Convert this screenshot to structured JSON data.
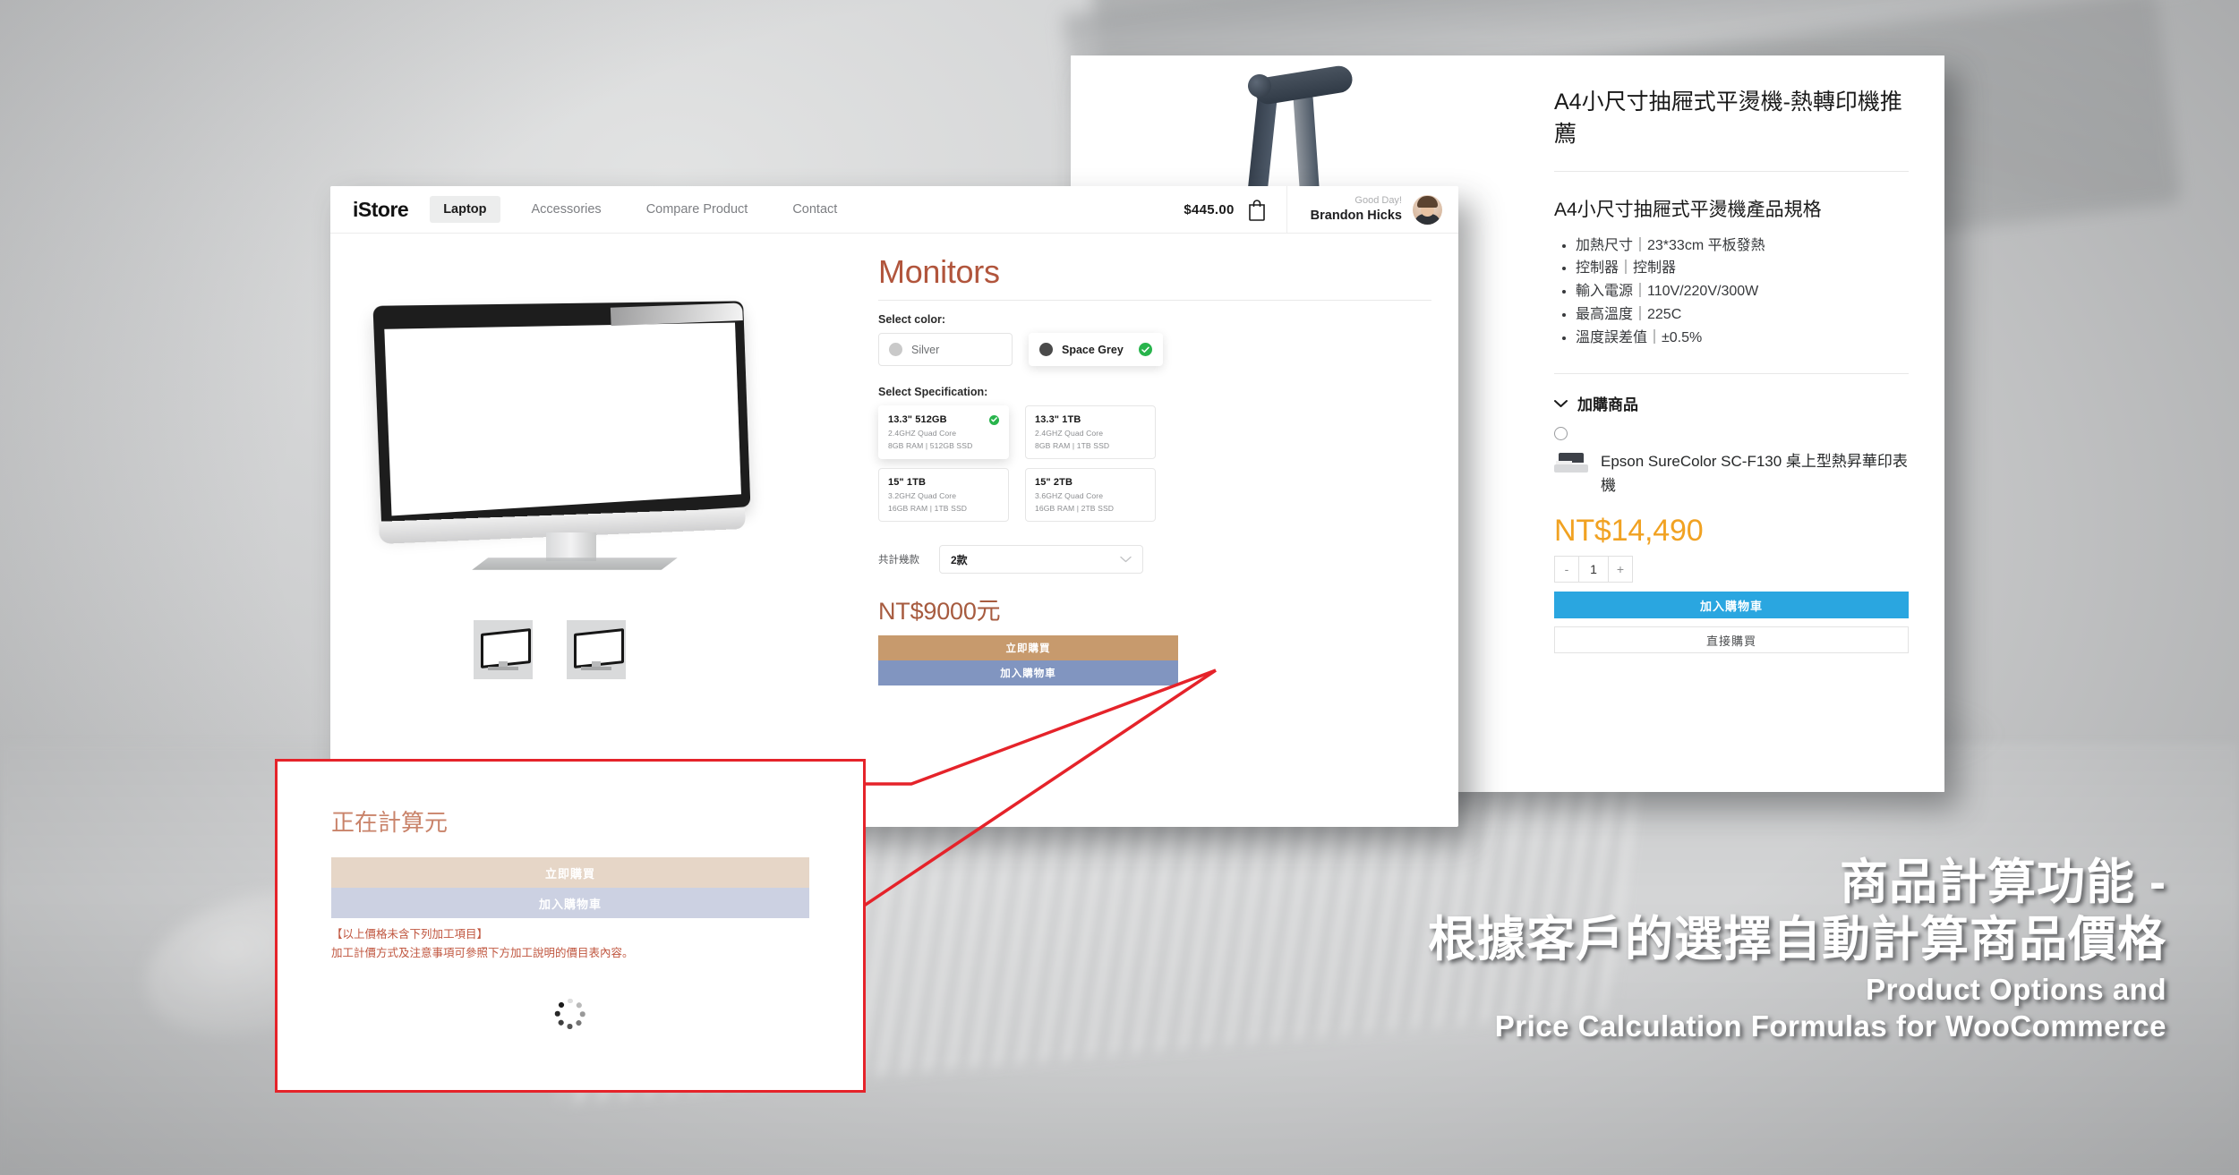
{
  "istore": {
    "brand": "iStore",
    "nav": [
      {
        "label": "Laptop",
        "active": true
      },
      {
        "label": "Accessories",
        "active": false
      },
      {
        "label": "Compare Product",
        "active": false
      },
      {
        "label": "Contact",
        "active": false
      }
    ],
    "cart_total": "$445.00",
    "cart_icon": "shopping-bag-icon",
    "greeting": "Good Day!",
    "user_name": "Brandon Hicks",
    "product_title": "Monitors",
    "color_label": "Select color:",
    "colors": [
      {
        "name": "Silver",
        "swatch": "#c9c9c9",
        "selected": false
      },
      {
        "name": "Space Grey",
        "swatch": "#4a4a4a",
        "selected": true
      }
    ],
    "spec_label": "Select Specification:",
    "specs": [
      {
        "title": "13.3\" 512GB",
        "cpu": "2.4GHZ Quad Core",
        "mem": "8GB RAM | 512GB SSD",
        "selected": true
      },
      {
        "title": "13.3\" 1TB",
        "cpu": "2.4GHZ Quad Core",
        "mem": "8GB RAM | 1TB SSD",
        "selected": false
      },
      {
        "title": "15\" 1TB",
        "cpu": "3.2GHZ Quad Core",
        "mem": "16GB RAM | 1TB SSD",
        "selected": false
      },
      {
        "title": "15\" 2TB",
        "cpu": "3.6GHZ Quad Core",
        "mem": "16GB RAM | 2TB SSD",
        "selected": false
      }
    ],
    "qty_label": "共計幾款",
    "qty_value": "2款",
    "qty_chevron": "chevron-down-icon",
    "price": "NT$9000元",
    "buy_now": "立即購買",
    "add_to_cart": "加入購物車",
    "accent_buy": "#c79a6d",
    "accent_cart": "#8195c0",
    "accent_title": "#b1553c"
  },
  "rightpanel": {
    "title": "A4小尺寸抽屜式平燙機-熱轉印機推薦",
    "spec_heading": "A4小尺寸抽屜式平燙機產品規格",
    "specs": [
      "加熱尺寸｜23*33cm 平板發熱",
      "控制器｜控制器",
      "輸入電源｜110V/220V/300W",
      "最高溫度｜225C",
      "溫度誤差值｜±0.5%"
    ],
    "addon_caret": "chevron-down-icon",
    "addon_heading": "加購商品",
    "addon_radio": "radio-unchecked-icon",
    "addon_name": "Epson SureColor SC-F130 桌上型熱昇華印表機",
    "price": "NT$14,490",
    "price_color": "#f1a222",
    "stepper_minus": "-",
    "stepper_value": "1",
    "stepper_plus": "+",
    "add_to_cart": "加入購物車",
    "buy_now": "直接購買",
    "cart_color": "#2aa6e0"
  },
  "popup": {
    "title": "正在計算元",
    "buy_now": "立即購買",
    "add_to_cart": "加入購物車",
    "note_line1": "【以上價格未含下列加工項目】",
    "note_line2": "加工計價方式及注意事項可參照下方加工說明的價目表內容。",
    "spinner": "loading-spinner-icon",
    "border_color": "#e5232a"
  },
  "caption": {
    "line1": "商品計算功能 -",
    "line2": "根據客戶的選擇自動計算商品價格",
    "line3": "Product Options and",
    "line4": "Price Calculation Formulas for WooCommerce"
  }
}
